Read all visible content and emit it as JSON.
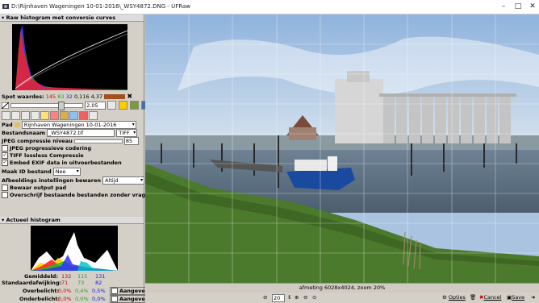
{
  "window": {
    "title": "D:\\Rijnhaven Wageningen 10-01-2016\\_WSY4872.DNG - UFRaw",
    "minimize": "–",
    "maximize": "□",
    "close": "✕"
  },
  "raw_histogram": {
    "header": "Raw histogram met conversie curves",
    "spot_label": "Spot waardes:",
    "spot_r": "145",
    "spot_g": "83",
    "spot_b": "32",
    "spot_lum": "0,116",
    "spot_val": "4,37",
    "spot_color": "#a0521c",
    "exposure_value": "2,05"
  },
  "output": {
    "pad_label": "Pad",
    "pad_value": "Rijnhaven Wageningen 10-01-2016",
    "filename_label": "Bestandsnaam",
    "filename_value": "_WSY4872.tif",
    "format_value": "TIFF",
    "jpeg_label": "JPEG compressie niveau",
    "jpeg_value": "85",
    "opt_progressive": "JPEG progressieve codering",
    "opt_tiff_lossless": "TIFF lossless Compressie",
    "opt_exif": "Embed EXIF data in uitvoerbestanden",
    "idfile_label": "Maak ID bestand",
    "idfile_value": "Nee",
    "save_settings_label": "Afbeeldings instellingen bewaren",
    "save_settings_value": "Altijd",
    "opt_remember_path": "Bewaar output pad",
    "opt_overwrite": "Overschrijf bestaande bestanden zonder vragen"
  },
  "live_histogram": {
    "header": "Actueel histogram",
    "avg_label": "Gemiddeld:",
    "avg_r": "132",
    "avg_g": "115",
    "avg_b": "131",
    "std_label": "Standaardafwijking:",
    "std_r": "71",
    "std_g": "73",
    "std_b": "82",
    "over_label": "Overbelicht:",
    "over_r": "0,0%",
    "over_g": "0,4%",
    "over_b": "0,5%",
    "under_label": "Onderbelicht:",
    "under_r": "0,0%",
    "under_g": "0,0%",
    "under_b": "0,0%",
    "indicate_label": "Aangeven"
  },
  "preview": {
    "status": "afmeting 6028x4024, zoom 20%"
  },
  "bottom": {
    "zoom_value": "20",
    "options_label": "Opties",
    "cancel_label": "Cancel",
    "save_label": "Save"
  },
  "colors": {
    "panel": "#d4d0c8",
    "sky": "#a9c3e0",
    "grass": "#4c7a2c",
    "water": "#5d7385",
    "boat_blue": "#1a4aa0"
  }
}
